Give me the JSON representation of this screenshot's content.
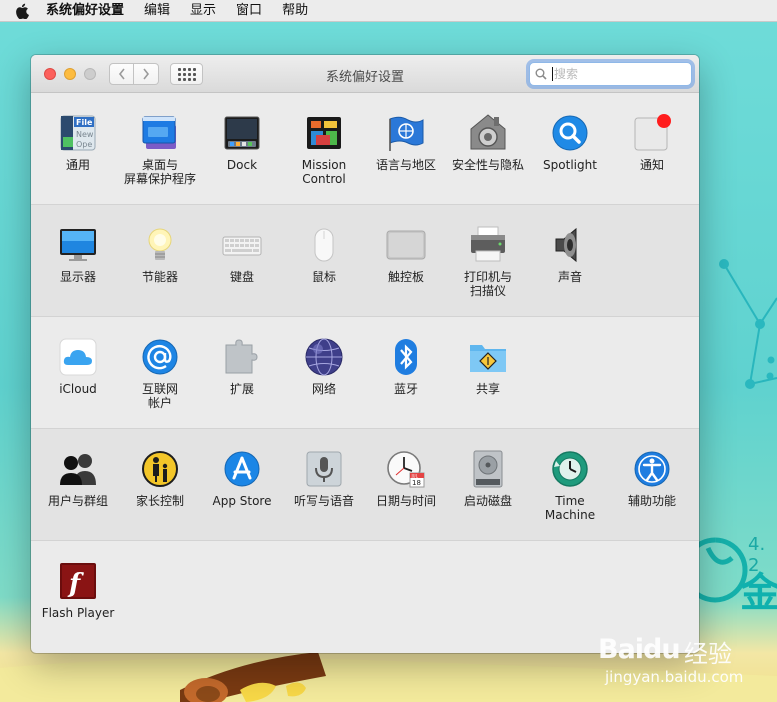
{
  "menubar": {
    "apple_icon": "apple-icon",
    "app_name": "系统偏好设置",
    "items": [
      "编辑",
      "显示",
      "窗口",
      "帮助"
    ]
  },
  "window": {
    "title": "系统偏好设置",
    "search_placeholder": "搜索"
  },
  "sections": [
    [
      {
        "label": "通用",
        "icon": "general-icon"
      },
      {
        "label": "桌面与\n屏幕保护程序",
        "icon": "desktop-screensaver-icon"
      },
      {
        "label": "Dock",
        "icon": "dock-icon"
      },
      {
        "label": "Mission\nControl",
        "icon": "mission-control-icon"
      },
      {
        "label": "语言与地区",
        "icon": "language-region-icon"
      },
      {
        "label": "安全性与隐私",
        "icon": "security-privacy-icon"
      },
      {
        "label": "Spotlight",
        "icon": "spotlight-icon"
      },
      {
        "label": "通知",
        "icon": "notifications-icon"
      }
    ],
    [
      {
        "label": "显示器",
        "icon": "displays-icon"
      },
      {
        "label": "节能器",
        "icon": "energy-saver-icon"
      },
      {
        "label": "键盘",
        "icon": "keyboard-icon"
      },
      {
        "label": "鼠标",
        "icon": "mouse-icon"
      },
      {
        "label": "触控板",
        "icon": "trackpad-icon"
      },
      {
        "label": "打印机与\n扫描仪",
        "icon": "printers-scanners-icon"
      },
      {
        "label": "声音",
        "icon": "sound-icon"
      }
    ],
    [
      {
        "label": "iCloud",
        "icon": "icloud-icon"
      },
      {
        "label": "互联网\n帐户",
        "icon": "internet-accounts-icon"
      },
      {
        "label": "扩展",
        "icon": "extensions-icon"
      },
      {
        "label": "网络",
        "icon": "network-icon"
      },
      {
        "label": "蓝牙",
        "icon": "bluetooth-icon"
      },
      {
        "label": "共享",
        "icon": "sharing-icon"
      }
    ],
    [
      {
        "label": "用户与群组",
        "icon": "users-groups-icon"
      },
      {
        "label": "家长控制",
        "icon": "parental-controls-icon"
      },
      {
        "label": "App Store",
        "icon": "app-store-icon"
      },
      {
        "label": "听写与语音",
        "icon": "dictation-speech-icon"
      },
      {
        "label": "日期与时间",
        "icon": "date-time-icon"
      },
      {
        "label": "启动磁盘",
        "icon": "startup-disk-icon"
      },
      {
        "label": "Time Machine",
        "icon": "time-machine-icon"
      },
      {
        "label": "辅助功能",
        "icon": "accessibility-icon"
      }
    ],
    [
      {
        "label": "Flash Player",
        "icon": "flash-player-icon"
      }
    ]
  ],
  "icon_text": {
    "general_file": "File",
    "general_new": "New",
    "general_ope": "Ope",
    "calendar_month": "JUL",
    "calendar_day": "18",
    "flash_letter": "f"
  },
  "colors": {
    "traffic_close": "#fc605c",
    "traffic_minimize": "#fdbc40",
    "traffic_zoom": "#cdcdcd",
    "desktop": "#62d4d1",
    "search_focus": "#6b9be6",
    "notification_badge": "#ff1d1d",
    "flash_red": "#6b0d0d"
  },
  "desktop": {
    "decor_number": "4. 2",
    "decor_char": "金"
  },
  "watermark": {
    "brand": "Baidu",
    "product": "经验",
    "url": "jingyan.baidu.com"
  }
}
